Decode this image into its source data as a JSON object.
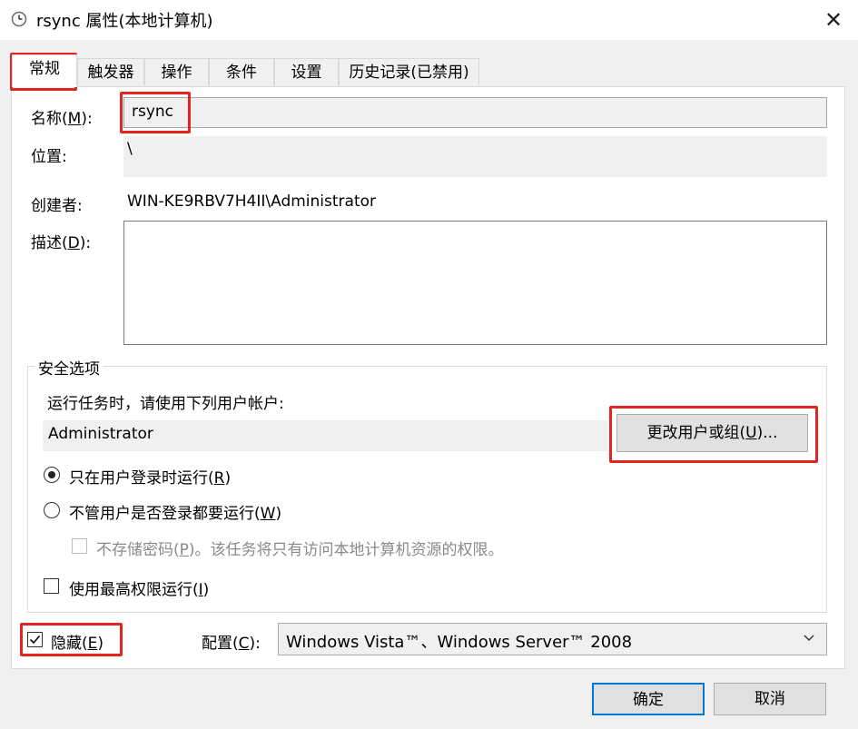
{
  "window": {
    "title": "rsync 属性(本地计算机)",
    "close_glyph": "✕",
    "title_icon": "clock-icon"
  },
  "tabs": [
    {
      "label": "常规"
    },
    {
      "label": "触发器"
    },
    {
      "label": "操作"
    },
    {
      "label": "条件"
    },
    {
      "label": "设置"
    },
    {
      "label": "历史记录(已禁用)"
    }
  ],
  "general": {
    "name_label": "名称(M):",
    "name_value": "rsync",
    "location_label": "位置:",
    "location_value": "\\",
    "author_label": "创建者:",
    "author_value": "WIN-KE9RBV7H4II\\Administrator",
    "description_label": "描述(D):",
    "description_value": ""
  },
  "security": {
    "group_title": "安全选项",
    "run_as_prompt": "运行任务时，请使用下列用户帐户:",
    "user_value": "Administrator",
    "change_user_button": "更改用户或组(U)...",
    "radio_logged_on": "只在用户登录时运行(R)",
    "radio_always": "不管用户是否登录都要运行(W)",
    "no_store_password": "不存储密码(P)。该任务将只有访问本地计算机资源的权限。",
    "highest_privileges": "使用最高权限运行(I)"
  },
  "bottom": {
    "hidden_label": "隐藏(E)",
    "hidden_checked": true,
    "configure_label": "配置(C):",
    "configure_value": "Windows Vista™、Windows Server™ 2008"
  },
  "buttons": {
    "ok": "确定",
    "cancel": "取消"
  },
  "colors": {
    "highlight": "#e0261e",
    "default_button_border": "#0078d7"
  }
}
